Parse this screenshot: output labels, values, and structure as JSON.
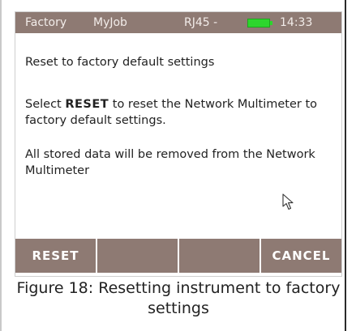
{
  "status_bar": {
    "app": "Factory",
    "job": "MyJob",
    "port": "RJ45 -",
    "time": "14:33",
    "battery_color": "#2dd62d"
  },
  "content": {
    "title": "Reset to factory default settings",
    "select_prefix": "Select ",
    "select_keyword": "RESET",
    "select_suffix": " to reset the Network Multimeter to factory default settings.",
    "data_notice": "All stored data will be removed from the Network Multimeter"
  },
  "softkeys": {
    "key1": "RESET",
    "key2": "",
    "key3": "",
    "key4": "CANCEL"
  },
  "caption": "Figure 18: Resetting instrument to factory settings",
  "colors": {
    "bar": "#8e7a73",
    "text": "#222222"
  }
}
